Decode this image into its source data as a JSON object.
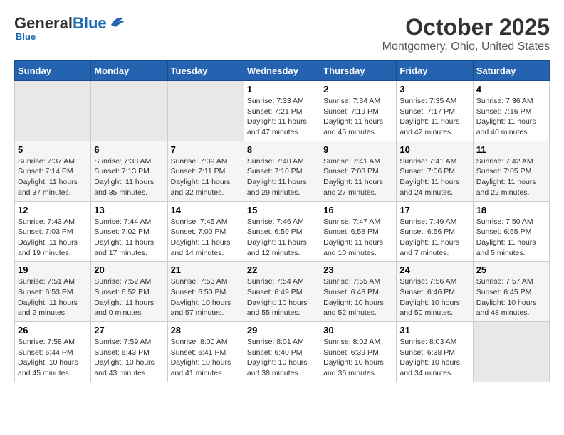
{
  "header": {
    "logo_general": "General",
    "logo_blue": "Blue",
    "month_title": "October 2025",
    "location": "Montgomery, Ohio, United States"
  },
  "days_of_week": [
    "Sunday",
    "Monday",
    "Tuesday",
    "Wednesday",
    "Thursday",
    "Friday",
    "Saturday"
  ],
  "weeks": [
    [
      {
        "num": "",
        "info": ""
      },
      {
        "num": "",
        "info": ""
      },
      {
        "num": "",
        "info": ""
      },
      {
        "num": "1",
        "info": "Sunrise: 7:33 AM\nSunset: 7:21 PM\nDaylight: 11 hours\nand 47 minutes."
      },
      {
        "num": "2",
        "info": "Sunrise: 7:34 AM\nSunset: 7:19 PM\nDaylight: 11 hours\nand 45 minutes."
      },
      {
        "num": "3",
        "info": "Sunrise: 7:35 AM\nSunset: 7:17 PM\nDaylight: 11 hours\nand 42 minutes."
      },
      {
        "num": "4",
        "info": "Sunrise: 7:36 AM\nSunset: 7:16 PM\nDaylight: 11 hours\nand 40 minutes."
      }
    ],
    [
      {
        "num": "5",
        "info": "Sunrise: 7:37 AM\nSunset: 7:14 PM\nDaylight: 11 hours\nand 37 minutes."
      },
      {
        "num": "6",
        "info": "Sunrise: 7:38 AM\nSunset: 7:13 PM\nDaylight: 11 hours\nand 35 minutes."
      },
      {
        "num": "7",
        "info": "Sunrise: 7:39 AM\nSunset: 7:11 PM\nDaylight: 11 hours\nand 32 minutes."
      },
      {
        "num": "8",
        "info": "Sunrise: 7:40 AM\nSunset: 7:10 PM\nDaylight: 11 hours\nand 29 minutes."
      },
      {
        "num": "9",
        "info": "Sunrise: 7:41 AM\nSunset: 7:08 PM\nDaylight: 11 hours\nand 27 minutes."
      },
      {
        "num": "10",
        "info": "Sunrise: 7:41 AM\nSunset: 7:06 PM\nDaylight: 11 hours\nand 24 minutes."
      },
      {
        "num": "11",
        "info": "Sunrise: 7:42 AM\nSunset: 7:05 PM\nDaylight: 11 hours\nand 22 minutes."
      }
    ],
    [
      {
        "num": "12",
        "info": "Sunrise: 7:43 AM\nSunset: 7:03 PM\nDaylight: 11 hours\nand 19 minutes."
      },
      {
        "num": "13",
        "info": "Sunrise: 7:44 AM\nSunset: 7:02 PM\nDaylight: 11 hours\nand 17 minutes."
      },
      {
        "num": "14",
        "info": "Sunrise: 7:45 AM\nSunset: 7:00 PM\nDaylight: 11 hours\nand 14 minutes."
      },
      {
        "num": "15",
        "info": "Sunrise: 7:46 AM\nSunset: 6:59 PM\nDaylight: 11 hours\nand 12 minutes."
      },
      {
        "num": "16",
        "info": "Sunrise: 7:47 AM\nSunset: 6:58 PM\nDaylight: 11 hours\nand 10 minutes."
      },
      {
        "num": "17",
        "info": "Sunrise: 7:49 AM\nSunset: 6:56 PM\nDaylight: 11 hours\nand 7 minutes."
      },
      {
        "num": "18",
        "info": "Sunrise: 7:50 AM\nSunset: 6:55 PM\nDaylight: 11 hours\nand 5 minutes."
      }
    ],
    [
      {
        "num": "19",
        "info": "Sunrise: 7:51 AM\nSunset: 6:53 PM\nDaylight: 11 hours\nand 2 minutes."
      },
      {
        "num": "20",
        "info": "Sunrise: 7:52 AM\nSunset: 6:52 PM\nDaylight: 11 hours\nand 0 minutes."
      },
      {
        "num": "21",
        "info": "Sunrise: 7:53 AM\nSunset: 6:50 PM\nDaylight: 10 hours\nand 57 minutes."
      },
      {
        "num": "22",
        "info": "Sunrise: 7:54 AM\nSunset: 6:49 PM\nDaylight: 10 hours\nand 55 minutes."
      },
      {
        "num": "23",
        "info": "Sunrise: 7:55 AM\nSunset: 6:48 PM\nDaylight: 10 hours\nand 52 minutes."
      },
      {
        "num": "24",
        "info": "Sunrise: 7:56 AM\nSunset: 6:46 PM\nDaylight: 10 hours\nand 50 minutes."
      },
      {
        "num": "25",
        "info": "Sunrise: 7:57 AM\nSunset: 6:45 PM\nDaylight: 10 hours\nand 48 minutes."
      }
    ],
    [
      {
        "num": "26",
        "info": "Sunrise: 7:58 AM\nSunset: 6:44 PM\nDaylight: 10 hours\nand 45 minutes."
      },
      {
        "num": "27",
        "info": "Sunrise: 7:59 AM\nSunset: 6:43 PM\nDaylight: 10 hours\nand 43 minutes."
      },
      {
        "num": "28",
        "info": "Sunrise: 8:00 AM\nSunset: 6:41 PM\nDaylight: 10 hours\nand 41 minutes."
      },
      {
        "num": "29",
        "info": "Sunrise: 8:01 AM\nSunset: 6:40 PM\nDaylight: 10 hours\nand 38 minutes."
      },
      {
        "num": "30",
        "info": "Sunrise: 8:02 AM\nSunset: 6:39 PM\nDaylight: 10 hours\nand 36 minutes."
      },
      {
        "num": "31",
        "info": "Sunrise: 8:03 AM\nSunset: 6:38 PM\nDaylight: 10 hours\nand 34 minutes."
      },
      {
        "num": "",
        "info": ""
      }
    ]
  ]
}
